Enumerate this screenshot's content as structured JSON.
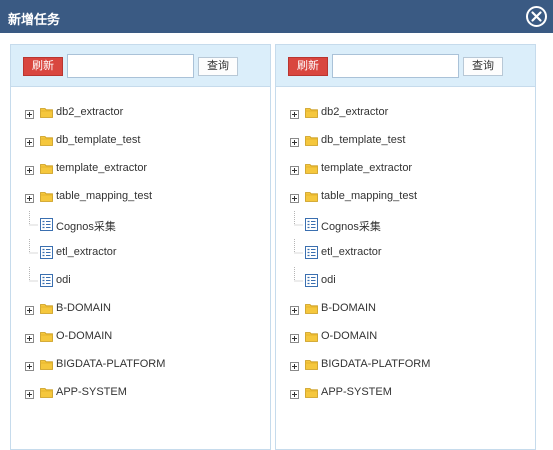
{
  "dialog": {
    "title": "新增任务"
  },
  "panels": [
    {
      "refresh_label": "刷新",
      "search_value": "",
      "query_label": "查询",
      "tree": [
        {
          "label": "db2_extractor",
          "type": "folder"
        },
        {
          "label": "db_template_test",
          "type": "folder"
        },
        {
          "label": "template_extractor",
          "type": "folder"
        },
        {
          "label": "table_mapping_test",
          "type": "folder"
        },
        {
          "label": "Cognos采集",
          "type": "leaf"
        },
        {
          "label": "etl_extractor",
          "type": "leaf"
        },
        {
          "label": "odi",
          "type": "leaf"
        },
        {
          "label": "B-DOMAIN",
          "type": "folder"
        },
        {
          "label": "O-DOMAIN",
          "type": "folder"
        },
        {
          "label": "BIGDATA-PLATFORM",
          "type": "folder"
        },
        {
          "label": "APP-SYSTEM",
          "type": "folder"
        }
      ]
    },
    {
      "refresh_label": "刷新",
      "search_value": "",
      "query_label": "查询",
      "tree": [
        {
          "label": "db2_extractor",
          "type": "folder"
        },
        {
          "label": "db_template_test",
          "type": "folder"
        },
        {
          "label": "template_extractor",
          "type": "folder"
        },
        {
          "label": "table_mapping_test",
          "type": "folder"
        },
        {
          "label": "Cognos采集",
          "type": "leaf"
        },
        {
          "label": "etl_extractor",
          "type": "leaf"
        },
        {
          "label": "odi",
          "type": "leaf"
        },
        {
          "label": "B-DOMAIN",
          "type": "folder"
        },
        {
          "label": "O-DOMAIN",
          "type": "folder"
        },
        {
          "label": "BIGDATA-PLATFORM",
          "type": "folder"
        },
        {
          "label": "APP-SYSTEM",
          "type": "folder"
        }
      ]
    }
  ],
  "icons": {
    "close": "close-circle-icon",
    "expand": "plus-box-icon",
    "folder": "folder-icon",
    "leaf": "document-list-icon"
  },
  "colors": {
    "titlebar": "#3a5a83",
    "panel_header": "#dbeefa",
    "panel_border": "#c6dbec",
    "refresh_button": "#d9463f",
    "folder": "#f5c73d"
  }
}
